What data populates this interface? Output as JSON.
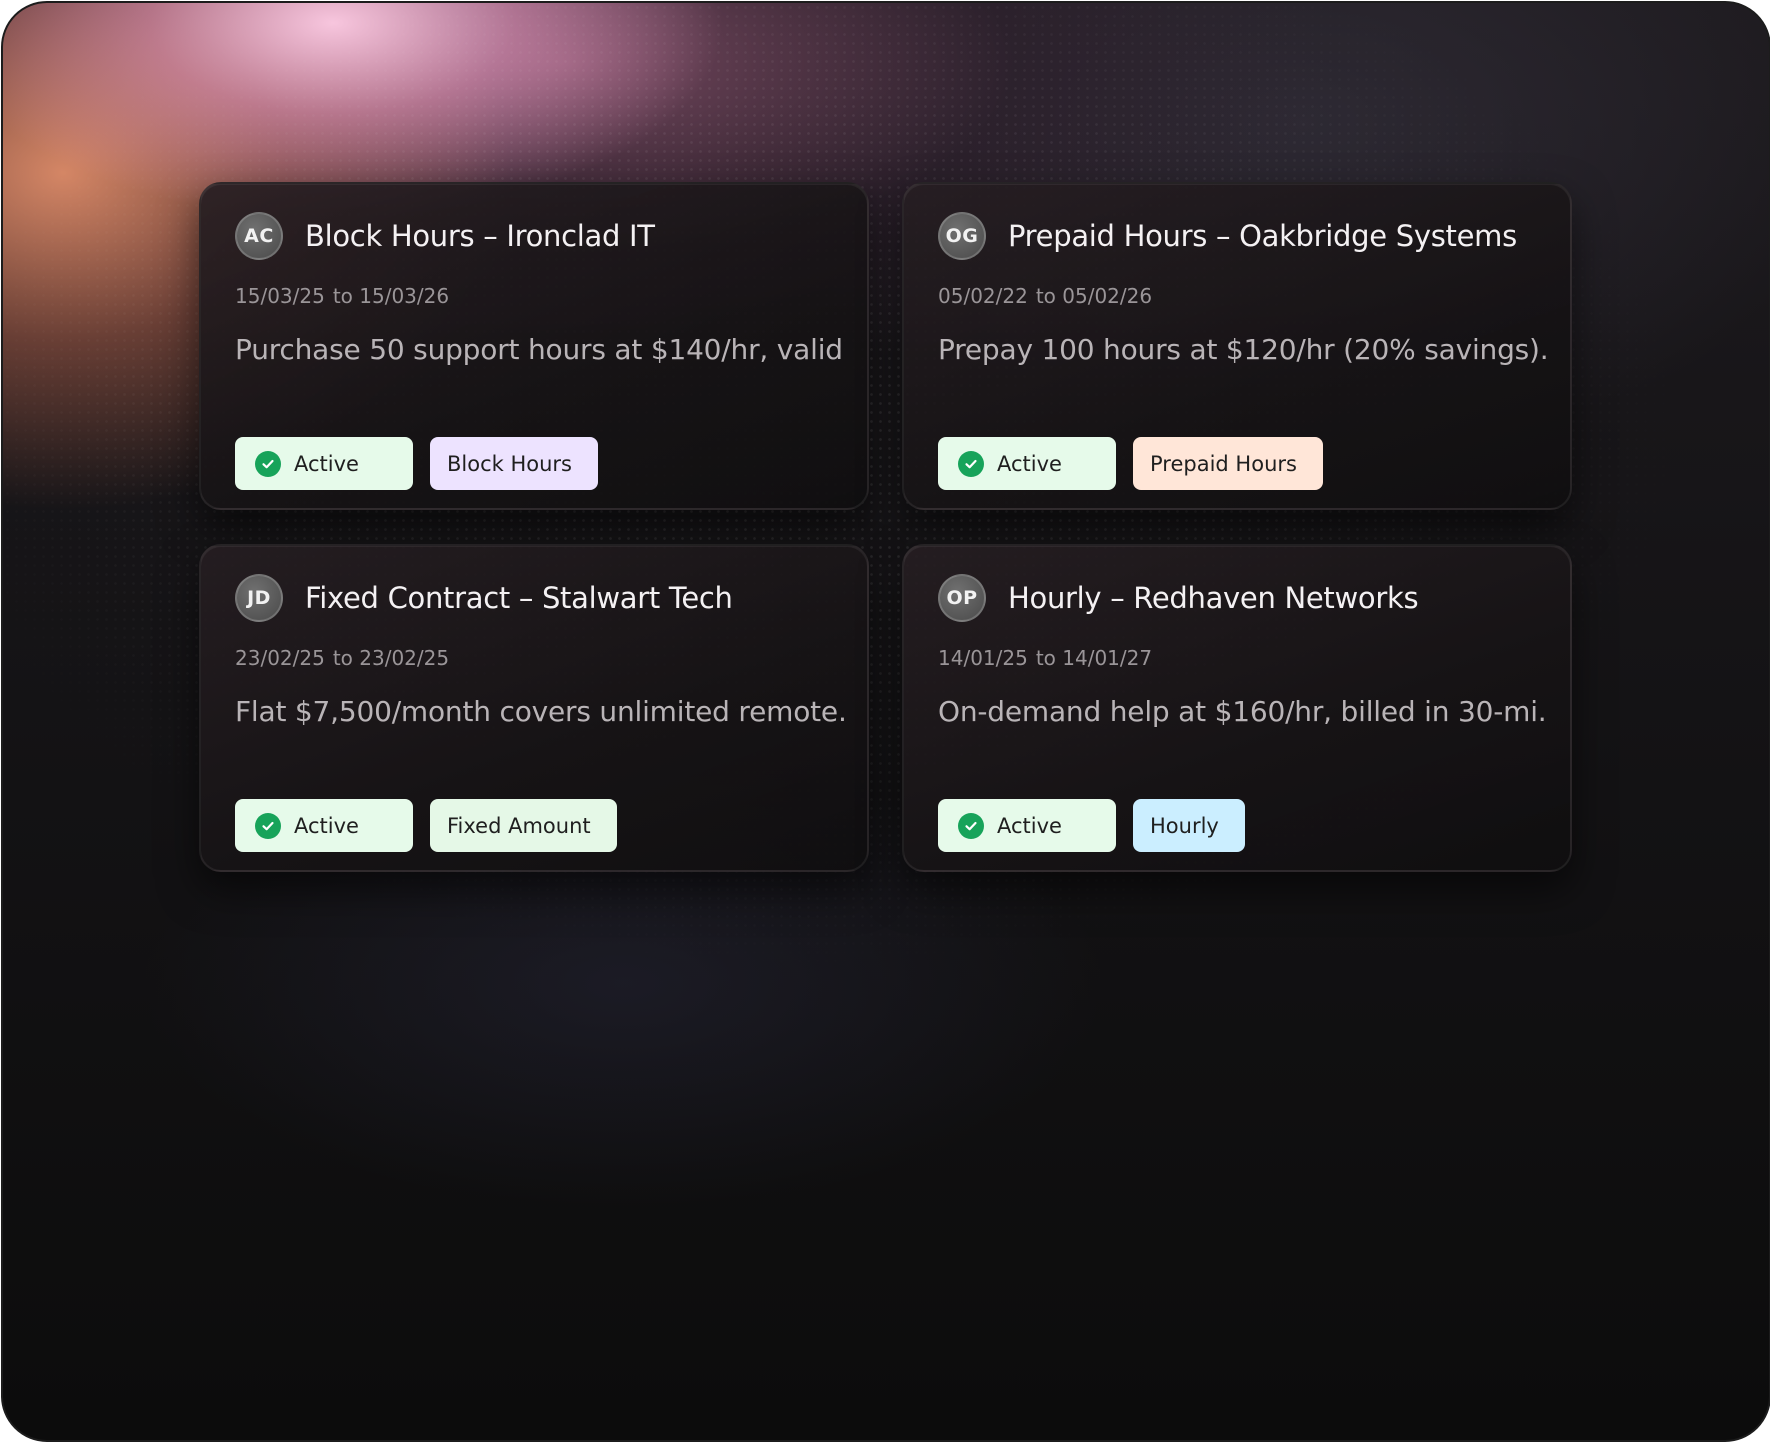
{
  "cards": [
    {
      "initials": "AC",
      "title": "Block Hours – Ironclad IT",
      "start_date": "15/03/25",
      "end_date": "to 15/03/26",
      "description": "Purchase 50 support hours at $140/hr, valid...",
      "status": "Active",
      "type_label": "Block Hours",
      "type_color": "#ede3ff"
    },
    {
      "initials": "OG",
      "title": "Prepaid Hours – Oakbridge Systems",
      "start_date": "05/02/22",
      "end_date": "to 05/02/26",
      "description": "Prepay 100 hours at $120/hr (20% savings)....",
      "status": "Active",
      "type_label": "Prepaid Hours",
      "type_color": "#ffe6d8"
    },
    {
      "initials": "JD",
      "title": "Fixed Contract – Stalwart Tech",
      "start_date": "23/02/25",
      "end_date": "to 23/02/25",
      "description": "Flat $7,500/month covers unlimited remote...",
      "status": "Active",
      "type_label": "Fixed Amount",
      "type_color": "#e5f8e7"
    },
    {
      "initials": "OP",
      "title": "Hourly – Redhaven Networks",
      "start_date": "14/01/25",
      "end_date": "to 14/01/27",
      "description": "On-demand help at $160/hr, billed in 30-mi...",
      "status": "Active",
      "type_label": "Hourly",
      "type_color": "#cbeeff"
    }
  ],
  "colors": {
    "status_badge_bg": "#e6faea",
    "status_check": "#17a35a",
    "card_bg": "#1a1618",
    "title_text": "#f4f1f3"
  },
  "icons": {
    "status": "check-circle-icon"
  }
}
